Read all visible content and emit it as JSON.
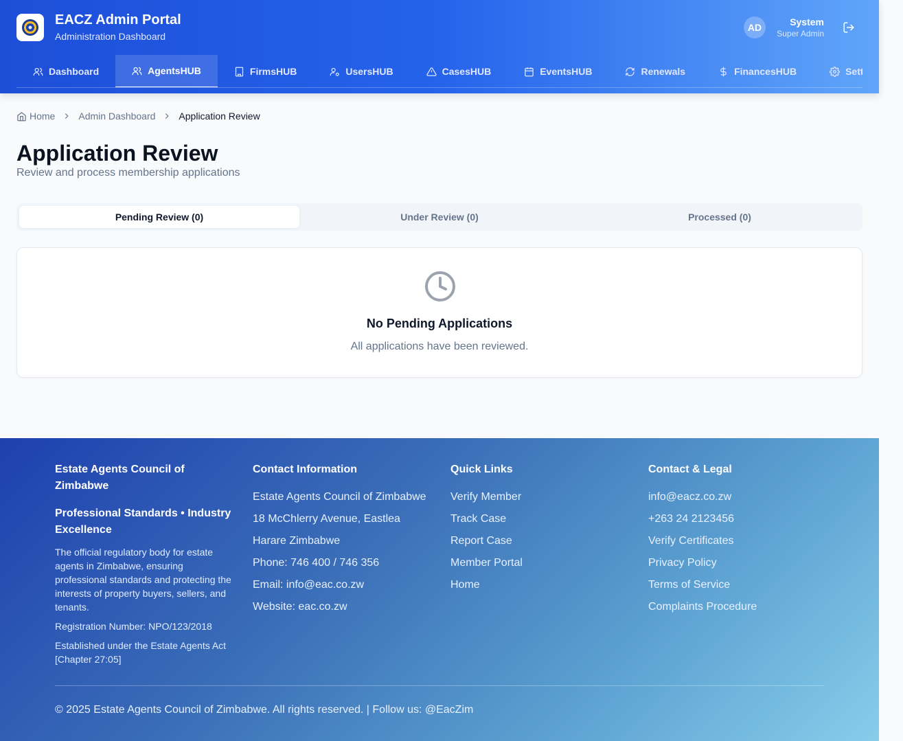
{
  "header": {
    "title": "EACZ Admin Portal",
    "subtitle": "Administration Dashboard",
    "user": {
      "initials": "AD",
      "name": "System",
      "role": "Super Admin"
    }
  },
  "nav": [
    {
      "label": "Dashboard",
      "icon": "users-icon"
    },
    {
      "label": "AgentsHUB",
      "icon": "users-icon",
      "active": true
    },
    {
      "label": "FirmsHUB",
      "icon": "building-icon"
    },
    {
      "label": "UsersHUB",
      "icon": "user-cog-icon"
    },
    {
      "label": "CasesHUB",
      "icon": "alert-triangle-icon"
    },
    {
      "label": "EventsHUB",
      "icon": "calendar-icon"
    },
    {
      "label": "Renewals",
      "icon": "refresh-icon"
    },
    {
      "label": "FinancesHUB",
      "icon": "dollar-icon"
    },
    {
      "label": "Settings",
      "icon": "gear-icon"
    }
  ],
  "breadcrumb": {
    "home": "Home",
    "parent": "Admin Dashboard",
    "current": "Application Review"
  },
  "page": {
    "title": "Application Review",
    "subtitle": "Review and process membership applications"
  },
  "tabs": [
    {
      "label": "Pending Review (0)",
      "active": true
    },
    {
      "label": "Under Review (0)"
    },
    {
      "label": "Processed (0)"
    }
  ],
  "empty_state": {
    "icon": "clock-icon",
    "title": "No Pending Applications",
    "message": "All applications have been reviewed."
  },
  "footer": {
    "about": {
      "title": "Estate Agents Council of Zimbabwe",
      "tagline": "Professional Standards • Industry Excellence",
      "description": "The official regulatory body for estate agents in Zimbabwe, ensuring professional standards and protecting the interests of property buyers, sellers, and tenants.",
      "registration": "Registration Number: NPO/123/2018",
      "established": "Established under the Estate Agents Act [Chapter 27:05]"
    },
    "contact": {
      "title": "Contact Information",
      "lines": [
        "Estate Agents Council of Zimbabwe",
        "18 McChlerry Avenue, Eastlea",
        "Harare Zimbabwe",
        "Phone: 746 400 / 746 356",
        "Email: info@eac.co.zw",
        "Website: eac.co.zw"
      ]
    },
    "quick_links": {
      "title": "Quick Links",
      "links": [
        "Verify Member",
        "Track Case",
        "Report Case",
        "Member Portal",
        "Home"
      ]
    },
    "legal": {
      "title": "Contact & Legal",
      "links": [
        "info@eacz.co.zw",
        "+263 24 2123456",
        "Verify Certificates",
        "Privacy Policy",
        "Terms of Service",
        "Complaints Procedure"
      ]
    },
    "copyright": "© 2025 Estate Agents Council of Zimbabwe. All rights reserved. | Follow us: @EacZim"
  },
  "colors": {
    "primary": "#2563eb",
    "header_start": "#1d4ed8",
    "footer_end": "#86cdea"
  }
}
